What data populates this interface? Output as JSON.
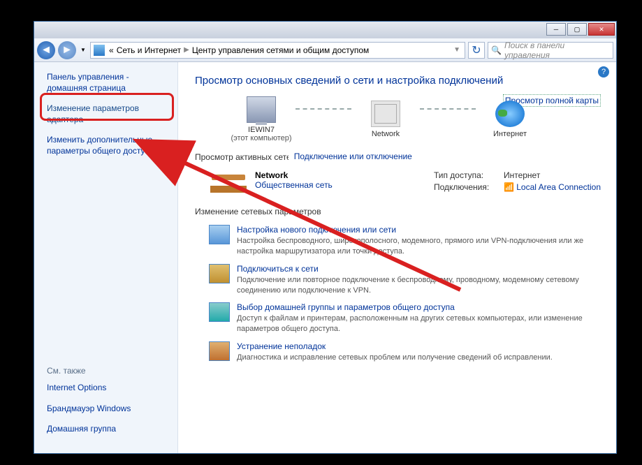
{
  "breadcrumb": {
    "prefix": "«",
    "seg1": "Сеть и Интернет",
    "seg2": "Центр управления сетями и общим доступом"
  },
  "search": {
    "placeholder": "Поиск в панели управления"
  },
  "sidebar": {
    "home": "Панель управления - домашняя страница",
    "adapters": "Изменение параметров адаптера",
    "advanced": "Изменить дополнительные параметры общего доступа",
    "seealso_label": "См. также",
    "seealso": [
      "Internet Options",
      "Брандмауэр Windows",
      "Домашняя группа"
    ]
  },
  "main": {
    "title": "Просмотр основных сведений о сети и настройка подключений",
    "maplink": "Просмотр полной карты",
    "nodes": {
      "pc": "IEWIN7",
      "pc_sub": "(этот компьютер)",
      "net": "Network",
      "inet": "Интернет"
    },
    "active_hdr": "Просмотр активных сетей",
    "conn_toggle": "Подключение или отключение",
    "network": {
      "name": "Network",
      "type": "Общественная сеть"
    },
    "accesstype_lbl": "Тип доступа:",
    "accesstype_val": "Интернет",
    "connections_lbl": "Подключения:",
    "connections_val": "Local Area Connection",
    "settings_hdr": "Изменение сетевых параметров",
    "items": [
      {
        "t": "Настройка нового подключения или сети",
        "d": "Настройка беспроводного, широкополосного, модемного, прямого или VPN-подключения или же настройка маршрутизатора или точки доступа."
      },
      {
        "t": "Подключиться к сети",
        "d": "Подключение или повторное подключение к беспроводному, проводному, модемному сетевому соединению или подключение к VPN."
      },
      {
        "t": "Выбор домашней группы и параметров общего доступа",
        "d": "Доступ к файлам и принтерам, расположенным на других сетевых компьютерах, или изменение параметров общего доступа."
      },
      {
        "t": "Устранение неполадок",
        "d": "Диагностика и исправление сетевых проблем или получение сведений об исправлении."
      }
    ]
  }
}
